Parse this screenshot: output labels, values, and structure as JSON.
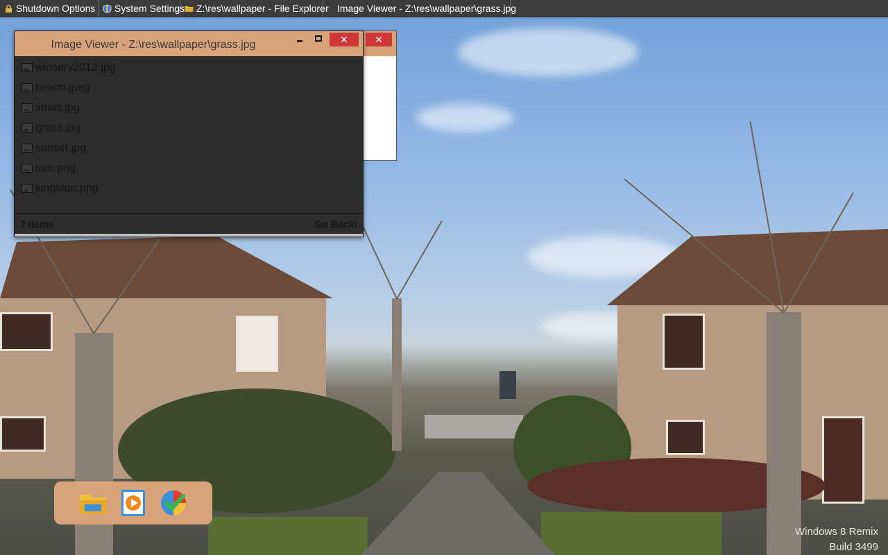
{
  "taskbar": {
    "items": [
      {
        "label": "Shutdown Options",
        "icon": "lock-icon"
      },
      {
        "label": "System Settings",
        "icon": "shield-icon"
      },
      {
        "label": "Z:\\res\\wallpaper - File Explorer",
        "icon": "folder-icon"
      },
      {
        "label": "Image Viewer - Z:\\res\\wallpaper\\grass.jpg",
        "icon": "image-icon"
      }
    ]
  },
  "viewer": {
    "title": "Image Viewer - Z:\\res\\wallpaper\\grass.jpg",
    "minimize_label": "▁",
    "maximize_label": "▫",
    "close_label": "✕",
    "files": [
      "winserv2012.jpg",
      "beach.jpeg",
      "xmas.jpg",
      "grass.jpg",
      "sunset.jpg",
      "tam.png",
      "kingston.png"
    ],
    "status_count": "7 items",
    "go_back_label": "Go Back!"
  },
  "background_window": {
    "close_label": "✕"
  },
  "dock": {
    "items": [
      {
        "name": "file-explorer",
        "icon": "folder-icon"
      },
      {
        "name": "media-player",
        "icon": "play-icon"
      },
      {
        "name": "browser",
        "icon": "globe-icon"
      }
    ]
  },
  "watermark": {
    "line1": "Windows 8 Remix",
    "line2": "Build 3499"
  },
  "colors": {
    "accent": "#d8a27a",
    "close_red": "#d03838",
    "taskbar": "#3c3c3c",
    "viewer_bg": "#2c2c2c"
  }
}
